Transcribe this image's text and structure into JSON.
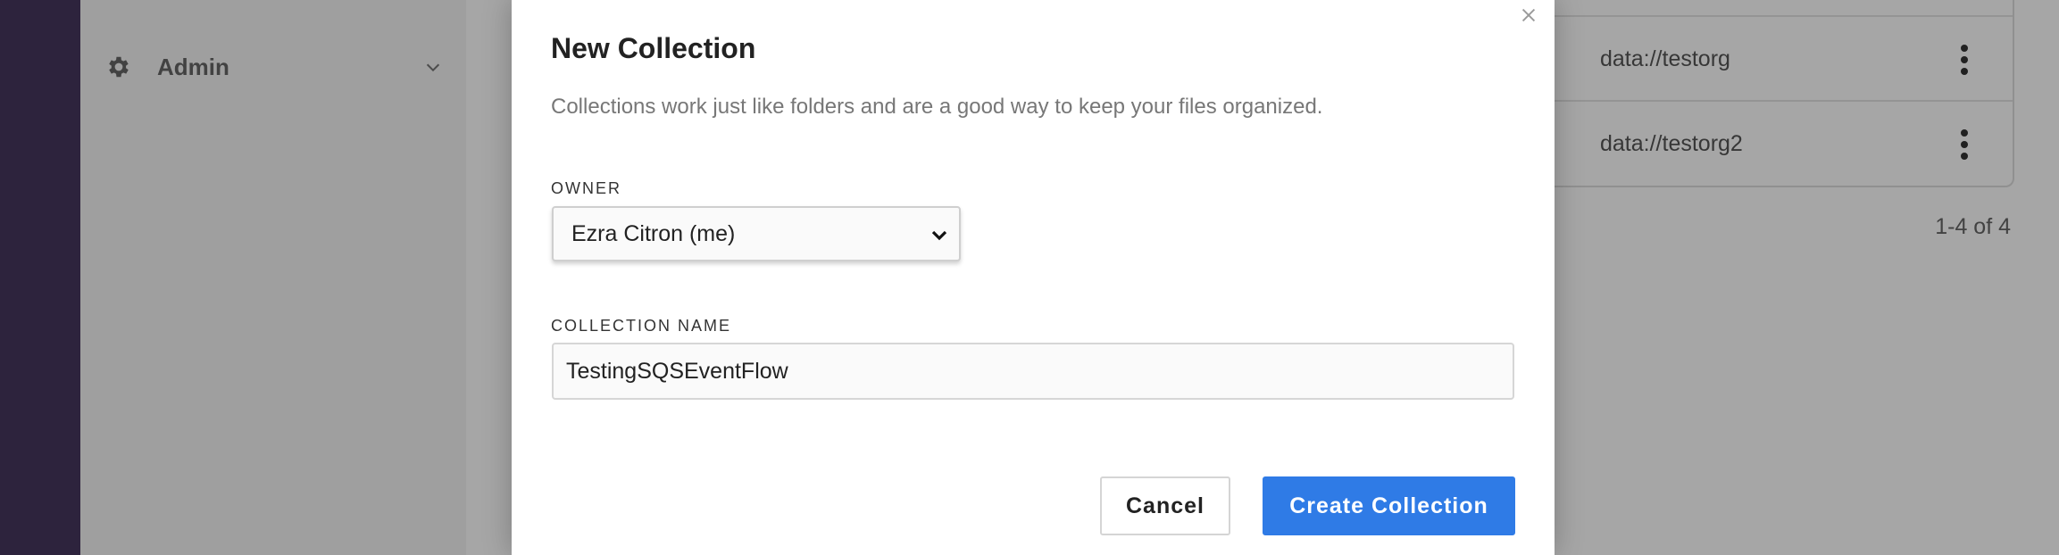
{
  "sidebar": {
    "admin_label": "Admin",
    "admin_icon": "gear-icon",
    "expand_icon": "chevron-down-icon"
  },
  "background_table": {
    "rows": [
      {
        "address": "data://testorg"
      },
      {
        "address": "data://testorg2"
      }
    ],
    "pagination": "1-4 of 4"
  },
  "modal": {
    "title": "New Collection",
    "description": "Collections work just like folders and are a good way to keep your files organized.",
    "owner": {
      "label": "OWNER",
      "selected": "Ezra Citron (me)"
    },
    "collection_name": {
      "label": "COLLECTION NAME",
      "value": "TestingSQSEventFlow"
    },
    "buttons": {
      "cancel": "Cancel",
      "create": "Create Collection"
    }
  },
  "colors": {
    "left_rail": "#45375f",
    "primary_button": "#2f7be6"
  }
}
